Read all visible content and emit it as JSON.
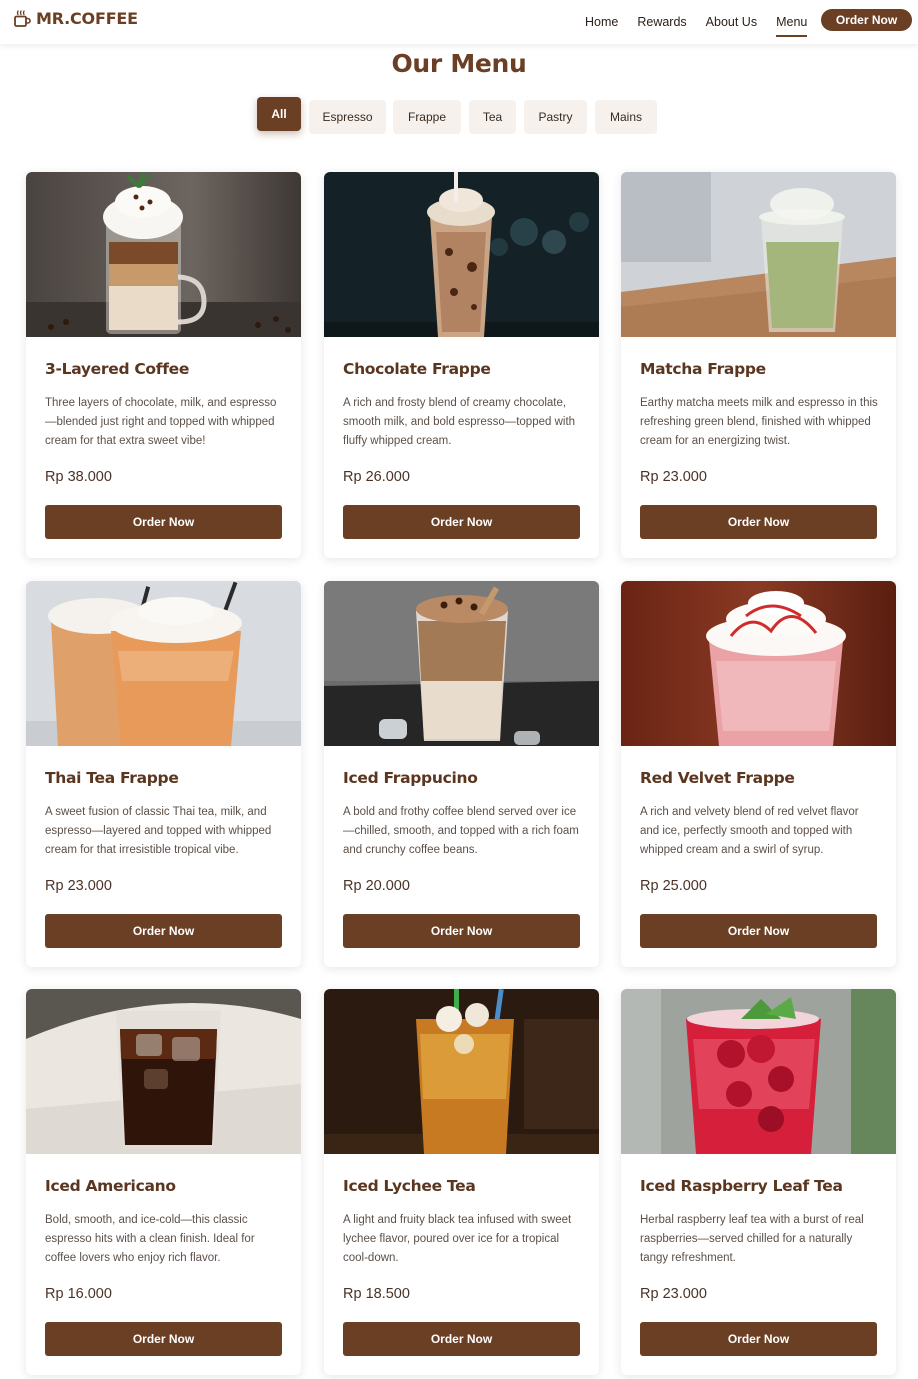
{
  "header": {
    "brand": "MR.COFFEE",
    "brand_icon": "coffee-cup-icon",
    "nav": [
      "Home",
      "Rewards",
      "About Us",
      "Menu"
    ],
    "active_nav": "Menu",
    "cta": "Order Now"
  },
  "page_title": "Our Menu",
  "filters": [
    "All",
    "Espresso",
    "Frappe",
    "Tea",
    "Pastry",
    "Mains"
  ],
  "active_filter": "All",
  "colors": {
    "primary": "#6b3f24",
    "chip": "#f6f1ec"
  },
  "menu": [
    {
      "name": "3-Layered Coffee",
      "description": "Three layers of chocolate, milk, and espresso—blended just right and topped with whipped cream for that extra sweet vibe!",
      "price": "Rp 38.000",
      "button": "Order Now"
    },
    {
      "name": "Chocolate Frappe",
      "description": "A rich and frosty blend of creamy chocolate, smooth milk, and bold espresso—topped with fluffy whipped cream.",
      "price": "Rp 26.000",
      "button": "Order Now"
    },
    {
      "name": "Matcha Frappe",
      "description": "Earthy matcha meets milk and espresso in this refreshing green blend, finished with whipped cream for an energizing twist.",
      "price": "Rp 23.000",
      "button": "Order Now"
    },
    {
      "name": "Thai Tea Frappe",
      "description": "A sweet fusion of classic Thai tea, milk, and espresso—layered and topped with whipped cream for that irresistible tropical vibe.",
      "price": "Rp 23.000",
      "button": "Order Now"
    },
    {
      "name": "Iced Frappucino",
      "description": "A bold and frothy coffee blend served over ice—chilled, smooth, and topped with a rich foam and crunchy coffee beans.",
      "price": "Rp 20.000",
      "button": "Order Now"
    },
    {
      "name": "Red Velvet Frappe",
      "description": "A rich and velvety blend of red velvet flavor and ice, perfectly smooth and topped with whipped cream and a swirl of syrup.",
      "price": "Rp 25.000",
      "button": "Order Now"
    },
    {
      "name": "Iced Americano",
      "description": "Bold, smooth, and ice-cold—this classic espresso hits with a clean finish. Ideal for coffee lovers who enjoy rich flavor.",
      "price": "Rp 16.000",
      "button": "Order Now"
    },
    {
      "name": "Iced Lychee Tea",
      "description": "A light and fruity black tea infused with sweet lychee flavor, poured over ice for a tropical cool-down.",
      "price": "Rp 18.500",
      "button": "Order Now"
    },
    {
      "name": "Iced Raspberry Leaf Tea",
      "description": "Herbal raspberry leaf tea with a burst of real raspberries—served chilled for a naturally tangy refreshment.",
      "price": "Rp 23.000",
      "button": "Order Now"
    }
  ]
}
